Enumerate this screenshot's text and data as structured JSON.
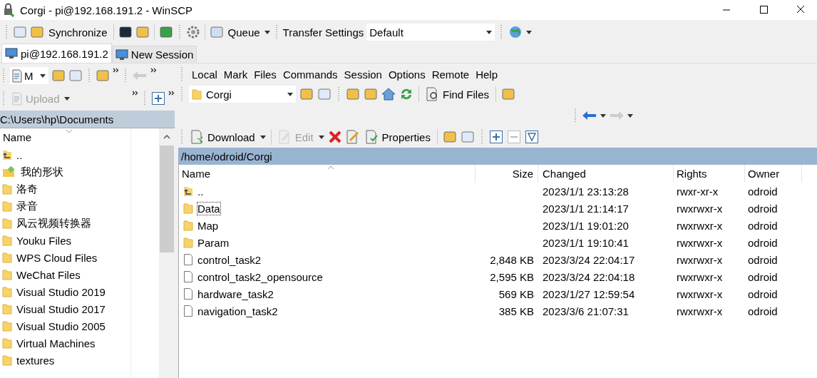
{
  "window": {
    "title": "Corgi - pi@192.168.191.2 - WinSCP"
  },
  "toolbar": {
    "synchronize": "Synchronize",
    "queue": "Queue",
    "transfer_settings": "Transfer Settings",
    "preset": "Default"
  },
  "tabs": [
    {
      "label": "pi@192.168.191.2",
      "selected": true
    },
    {
      "label": "New Session",
      "selected": false
    }
  ],
  "local": {
    "drive": "M",
    "upload": {
      "label": "Upload",
      "disabled": true
    },
    "path": "C:\\Users\\hp\\Documents",
    "column": "Name",
    "rows": [
      {
        "name": "..",
        "kind": "parent"
      },
      {
        "name": "我的形状",
        "kind": "special"
      },
      {
        "name": "洛奇",
        "kind": "folder"
      },
      {
        "name": "录音",
        "kind": "folder"
      },
      {
        "name": "风云视频转换器",
        "kind": "folder"
      },
      {
        "name": "Youku Files",
        "kind": "folder"
      },
      {
        "name": "WPS Cloud Files",
        "kind": "folder"
      },
      {
        "name": "WeChat Files",
        "kind": "folder"
      },
      {
        "name": "Visual Studio 2019",
        "kind": "folder"
      },
      {
        "name": "Visual Studio 2017",
        "kind": "folder"
      },
      {
        "name": "Visual Studio 2005",
        "kind": "folder"
      },
      {
        "name": "Virtual Machines",
        "kind": "folder"
      },
      {
        "name": "textures",
        "kind": "folder"
      }
    ]
  },
  "remote": {
    "menu": [
      "Local",
      "Mark",
      "Files",
      "Commands",
      "Session",
      "Options",
      "Remote",
      "Help"
    ],
    "location": "Corgi",
    "find_files": "Find Files",
    "download": {
      "label": "Download",
      "disabled": false
    },
    "edit": {
      "label": "Edit",
      "disabled": true
    },
    "properties": {
      "label": "Properties",
      "disabled": false
    },
    "path": "/home/odroid/Corgi",
    "columns": [
      "Name",
      "Size",
      "Changed",
      "Rights",
      "Owner"
    ],
    "rows": [
      {
        "kind": "parent",
        "name": "..",
        "size": "",
        "changed": "2023/1/1 23:13:28",
        "rights": "rwxr-xr-x",
        "owner": "odroid",
        "focused": false
      },
      {
        "kind": "folder",
        "name": "Data",
        "size": "",
        "changed": "2023/1/1 21:14:17",
        "rights": "rwxrwxr-x",
        "owner": "odroid",
        "focused": true
      },
      {
        "kind": "folder",
        "name": "Map",
        "size": "",
        "changed": "2023/1/1 19:01:20",
        "rights": "rwxrwxr-x",
        "owner": "odroid",
        "focused": false
      },
      {
        "kind": "folder",
        "name": "Param",
        "size": "",
        "changed": "2023/1/1 19:10:41",
        "rights": "rwxrwxr-x",
        "owner": "odroid",
        "focused": false
      },
      {
        "kind": "file",
        "name": "control_task2",
        "size": "2,848 KB",
        "changed": "2023/3/24 22:04:17",
        "rights": "rwxrwxr-x",
        "owner": "odroid",
        "focused": false
      },
      {
        "kind": "file",
        "name": "control_task2_opensource",
        "size": "2,595 KB",
        "changed": "2023/3/24 22:04:18",
        "rights": "rwxrwxr-x",
        "owner": "odroid",
        "focused": false
      },
      {
        "kind": "file",
        "name": "hardware_task2",
        "size": "569 KB",
        "changed": "2023/1/27 12:59:54",
        "rights": "rwxrwxr-x",
        "owner": "odroid",
        "focused": false
      },
      {
        "kind": "file",
        "name": "navigation_task2",
        "size": "385 KB",
        "changed": "2023/3/6 21:07:31",
        "rights": "rwxrwxr-x",
        "owner": "odroid",
        "focused": false
      }
    ]
  }
}
